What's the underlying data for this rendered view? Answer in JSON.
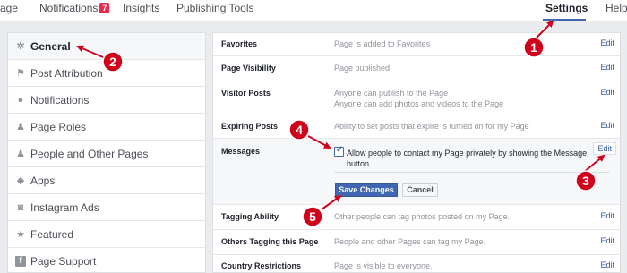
{
  "nav": {
    "items": [
      {
        "label": "age"
      },
      {
        "label": "Notifications",
        "badge": "7"
      },
      {
        "label": "Insights"
      },
      {
        "label": "Publishing Tools"
      }
    ],
    "settings_label": "Settings",
    "help_label": "Help"
  },
  "sidebar": {
    "items": [
      {
        "label": "General",
        "icon": "gear-icon",
        "active": true
      },
      {
        "label": "Post Attribution",
        "icon": "flag-icon"
      },
      {
        "label": "Notifications",
        "icon": "globe-icon"
      },
      {
        "label": "Page Roles",
        "icon": "person-icon"
      },
      {
        "label": "People and Other Pages",
        "icon": "people-icon"
      },
      {
        "label": "Apps",
        "icon": "cube-icon"
      },
      {
        "label": "Instagram Ads",
        "icon": "camera-icon"
      },
      {
        "label": "Featured",
        "icon": "star-icon"
      },
      {
        "label": "Page Support",
        "icon": "facebook-icon"
      }
    ]
  },
  "settings": {
    "favorites": {
      "label": "Favorites",
      "value": "Page is added to Favorites",
      "edit": "Edit"
    },
    "visibility": {
      "label": "Page Visibility",
      "value": "Page published",
      "edit": "Edit"
    },
    "visitor_posts": {
      "label": "Visitor Posts",
      "value1": "Anyone can publish to the Page",
      "value2": "Anyone can add photos and videos to the Page",
      "edit": "Edit"
    },
    "expiring": {
      "label": "Expiring Posts",
      "value": "Ability to set posts that expire is turned on for my Page",
      "edit": "Edit"
    },
    "messages": {
      "label": "Messages",
      "checkbox_line1": "Allow people to contact my Page privately by showing the Message",
      "checkbox_line2": "button",
      "checked": true,
      "edit": "Edit",
      "save": "Save Changes",
      "cancel": "Cancel"
    },
    "tagging": {
      "label": "Tagging Ability",
      "value": "Other people can tag photos posted on my Page.",
      "edit": "Edit"
    },
    "others_tagging": {
      "label": "Others Tagging this Page",
      "value": "People and other Pages can tag my Page.",
      "edit": "Edit"
    },
    "country": {
      "label": "Country Restrictions",
      "value": "Page is visible to everyone.",
      "edit": "Edit"
    }
  },
  "annotations": {
    "markers": [
      "1",
      "2",
      "3",
      "4",
      "5"
    ],
    "color": "#d0021b"
  },
  "colors": {
    "accent": "#4267b2",
    "link": "#365899",
    "badge": "#f02849"
  }
}
